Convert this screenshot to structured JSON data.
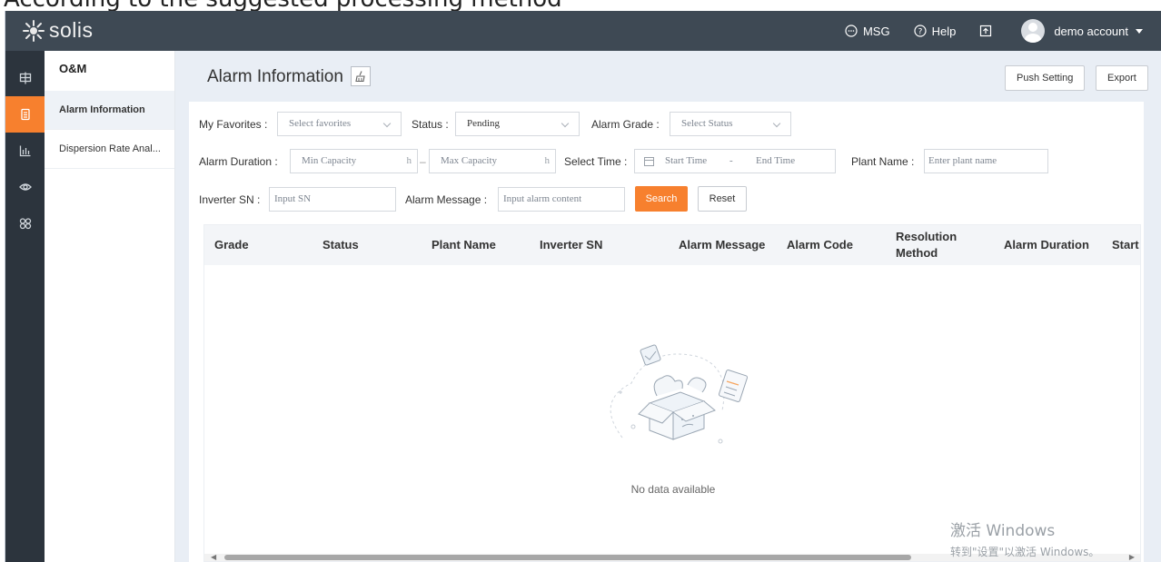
{
  "caption": {
    "text": "According to the suggested processing method"
  },
  "topbar": {
    "logo_text": "solis",
    "msg_label": "MSG",
    "help_label": "Help",
    "account_label": "demo account"
  },
  "iconbar": {
    "items": [
      {
        "icon": "grid-icon"
      },
      {
        "icon": "document-icon",
        "active": true
      },
      {
        "icon": "chart-icon"
      },
      {
        "icon": "eye-icon"
      },
      {
        "icon": "apps-icon"
      }
    ]
  },
  "subnav": {
    "title": "O&M",
    "items": [
      {
        "label": "Alarm Information",
        "active": true
      },
      {
        "label": "Dispersion Rate Anal..."
      }
    ]
  },
  "header": {
    "title": "Alarm Information",
    "push_setting_label": "Push Setting",
    "export_label": "Export"
  },
  "filters": {
    "favorites_label": "My Favorites :",
    "favorites_placeholder": "Select favorites",
    "status_label": "Status :",
    "status_value": "Pending",
    "grade_label": "Alarm Grade :",
    "grade_placeholder": "Select Status",
    "duration_label": "Alarm Duration :",
    "min_placeholder": "Min Capacity",
    "max_placeholder": "Max Capacity",
    "unit": "h",
    "range_sep": "–",
    "time_label": "Select Time :",
    "start_placeholder": "Start Time",
    "time_sep": "-",
    "end_placeholder": "End Time",
    "plant_label": "Plant Name :",
    "plant_placeholder": "Enter plant name",
    "sn_label": "Inverter SN :",
    "sn_placeholder": "Input SN",
    "message_label": "Alarm Message :",
    "message_placeholder": "Input alarm content",
    "search_label": "Search",
    "reset_label": "Reset"
  },
  "table": {
    "columns": [
      "Grade",
      "Status",
      "Plant Name",
      "Inverter SN",
      "Alarm Message",
      "Alarm Code",
      "Resolution Method",
      "Alarm Duration",
      "Start"
    ],
    "empty_text": "No data available"
  },
  "watermark": {
    "line1": "激活 Windows",
    "line2": "转到\"设置\"以激活 Windows。"
  }
}
